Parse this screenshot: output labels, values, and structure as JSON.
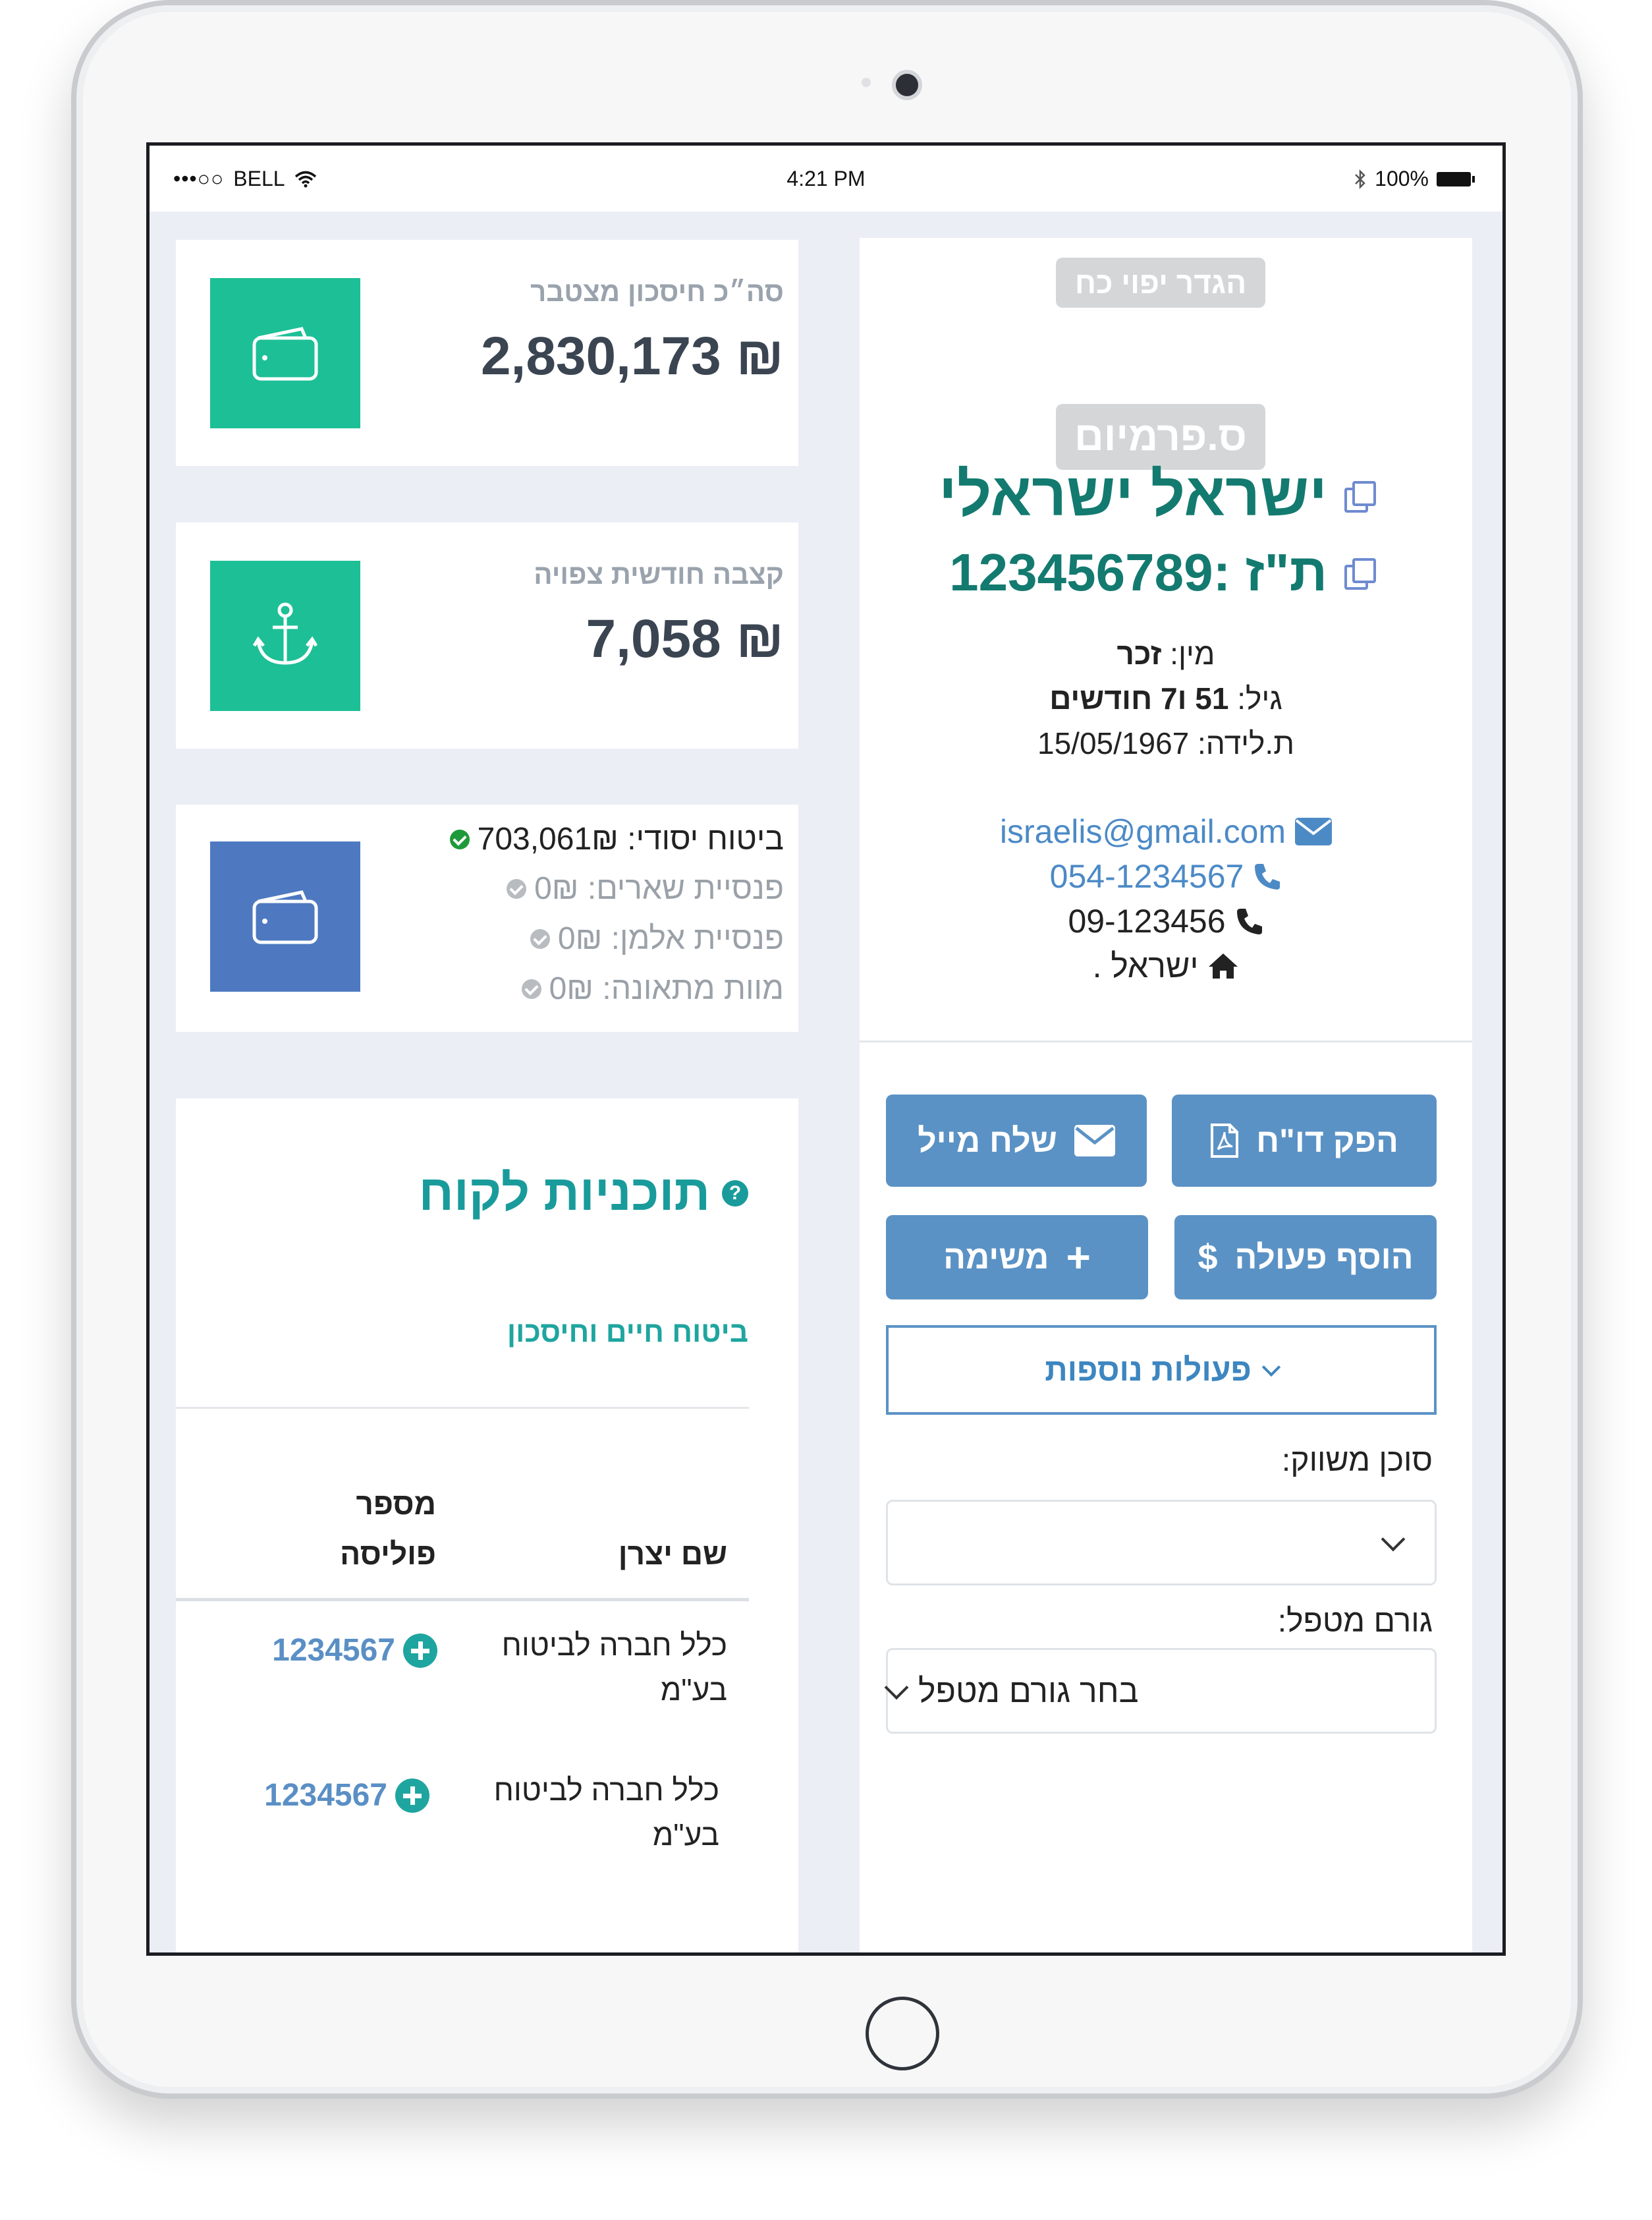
{
  "status_bar": {
    "signal": "•••○○",
    "carrier": "BELL",
    "time": "4:21 PM",
    "battery": "100%"
  },
  "stats": {
    "total_savings_label": "סה״כ חיסכון מצטבר",
    "total_savings_value": "₪ 2,830,173",
    "monthly_annuity_label": "קצבה חודשית צפויה",
    "monthly_annuity_value": "₪ 7,058"
  },
  "coverage": [
    {
      "label": "ביטוח יסודי: 703,061₪",
      "active": true
    },
    {
      "label": "פנסיית שארים: 0₪",
      "active": false
    },
    {
      "label": "פנסיית אלמן: 0₪",
      "active": false
    },
    {
      "label": "מוות מתאונה: 0₪",
      "active": false
    }
  ],
  "plans": {
    "title": "תוכניות לקוח",
    "help": "?",
    "category": "ביטוח חיים וחיסכון",
    "col_manufacturer": "שם יצרן",
    "col_policy_line1": "מספר",
    "col_policy_line2": "פוליסה",
    "rows": [
      {
        "manufacturer_line1": "כלל חברה לביטוח",
        "manufacturer_line2": "בע\"מ",
        "policy": "1234567"
      },
      {
        "manufacturer_line1": "כלל חברה לביטוח",
        "manufacturer_line2": "בע\"מ",
        "policy": "1234567"
      }
    ]
  },
  "profile": {
    "power_of_attorney_badge": "הגדר יפוי כח",
    "premium_badge": "ס.פרמיום",
    "name": "ישראל ישראלי",
    "id_line": "ת\"ז :123456789",
    "gender_label": "מין:",
    "gender_value": "זכר",
    "age_label": "גיל:",
    "age_value": "51 ו7 חודשים",
    "birth_label": "ת.לידה:",
    "birth_value": "15/05/1967",
    "email": "israelis@gmail.com",
    "mobile": "054-1234567",
    "phone": "09-123456",
    "address": "ישראל ."
  },
  "actions": {
    "report_button": "הפק דו\"ח",
    "email_button": "שלח מייל",
    "add_action_button": "הוסף פעולה",
    "task_button": "משימה",
    "more_actions": "פעולות נוספות",
    "marketing_agent_label": "סוכן משווק:",
    "marketing_agent_value": "",
    "handler_label": "גורם מטפל:",
    "handler_value": "בחר גורם מטפל"
  },
  "colors": {
    "teal": "#1dbf96",
    "blue": "#4e79c1",
    "button_blue": "#5b92c5",
    "name_green": "#137a70",
    "check_green": "#1e9a3a",
    "check_gray": "#b8bcc1"
  },
  "icons": {
    "wallet": "wallet-icon",
    "anchor": "anchor-icon",
    "envelope": "envelope-icon",
    "phone": "phone-icon",
    "home": "home-icon",
    "pdf": "pdf-icon",
    "copy": "copy-icon"
  }
}
